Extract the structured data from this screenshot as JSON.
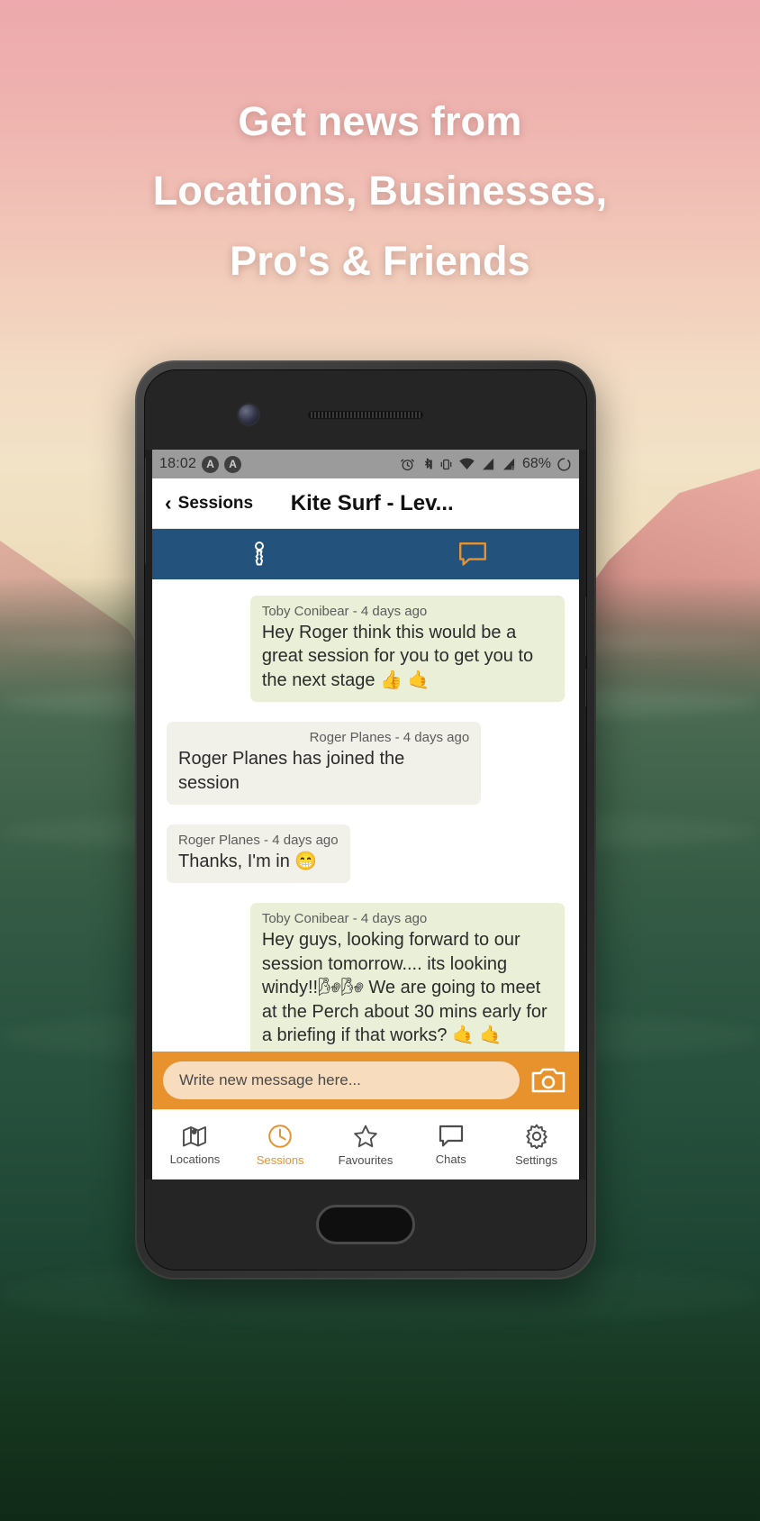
{
  "headline": {
    "lines": [
      "Get news from",
      "Locations, Businesses,",
      "Pro's & Friends"
    ]
  },
  "colors": {
    "accent_orange": "#e8922d",
    "tab_blue": "#23527c",
    "bubble_green": "#eaf0d8",
    "bubble_grey": "#f1f0e9",
    "headline_text": "#ffffff"
  },
  "status_bar": {
    "time": "18:02",
    "left_badges": [
      "A",
      "A"
    ],
    "icons": [
      "alarm-icon",
      "bluetooth-icon",
      "vibrate-icon",
      "wifi-icon",
      "signal-icon",
      "signal-roaming-icon"
    ],
    "battery": "68%"
  },
  "app_header": {
    "back_label": "Sessions",
    "back_icon": "chevron-left-icon",
    "title": "Kite Surf - Lev..."
  },
  "tabs": [
    {
      "icon": "session-info-icon",
      "active": false
    },
    {
      "icon": "chat-bubble-icon",
      "active": true
    }
  ],
  "messages": [
    {
      "meta": "Toby Conibear - 4 days ago",
      "body": "Hey Roger think this would be a great session for you to get you to the next stage 👍 🤙",
      "side": "right",
      "style": "green"
    },
    {
      "meta": "Roger Planes - 4 days ago",
      "body": "Roger Planes has joined the session",
      "side": "left",
      "style": "grey"
    },
    {
      "meta": "Roger Planes - 4 days ago",
      "body": "Thanks, I'm in 😁",
      "side": "left",
      "style": "grey"
    },
    {
      "meta": "Toby Conibear - 4 days ago",
      "body": "Hey guys, looking forward to our session tomorrow.... its looking windy!!🌬🌬 We are going to meet at the Perch  about 30 mins early for a briefing if that works? 🤙 🤙",
      "side": "right",
      "style": "green"
    }
  ],
  "composer": {
    "placeholder": "Write new message here...",
    "camera_icon": "camera-icon"
  },
  "bottom_nav": [
    {
      "label": "Locations",
      "icon": "map-icon",
      "active": false
    },
    {
      "label": "Sessions",
      "icon": "clock-icon",
      "active": true
    },
    {
      "label": "Favourites",
      "icon": "star-icon",
      "active": false
    },
    {
      "label": "Chats",
      "icon": "chat-icon",
      "active": false
    },
    {
      "label": "Settings",
      "icon": "gear-icon",
      "active": false
    }
  ]
}
